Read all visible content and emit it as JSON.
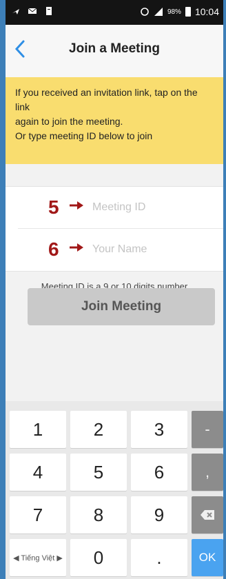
{
  "statusbar": {
    "battery": "98%",
    "time": "10:04"
  },
  "navbar": {
    "title": "Join a Meeting"
  },
  "banner": {
    "line1": "If you received an invitation link, tap on the link",
    "line2": "again to join the meeting.",
    "line3": "Or type meeting ID below to join"
  },
  "form": {
    "step1": "5",
    "step2": "6",
    "meeting_id_placeholder": "Meeting ID",
    "name_placeholder": "Your Name",
    "hint": "Meeting ID is a 9 or 10 digits number",
    "join_label": "Join Meeting"
  },
  "keypad": {
    "k1": "1",
    "k2": "2",
    "k3": "3",
    "dash": "-",
    "k4": "4",
    "k5": "5",
    "k6": "6",
    "comma": ",",
    "k7": "7",
    "k8": "8",
    "k9": "9",
    "lang": "◀ Tiếng Việt ▶",
    "k0": "0",
    "dot": ".",
    "ok": "OK"
  },
  "colors": {
    "accent": "#2f8fe5",
    "banner": "#f9dd6f",
    "step_marker": "#a11818",
    "join_disabled": "#c9c9c9",
    "ok_key": "#4aa3f0"
  }
}
